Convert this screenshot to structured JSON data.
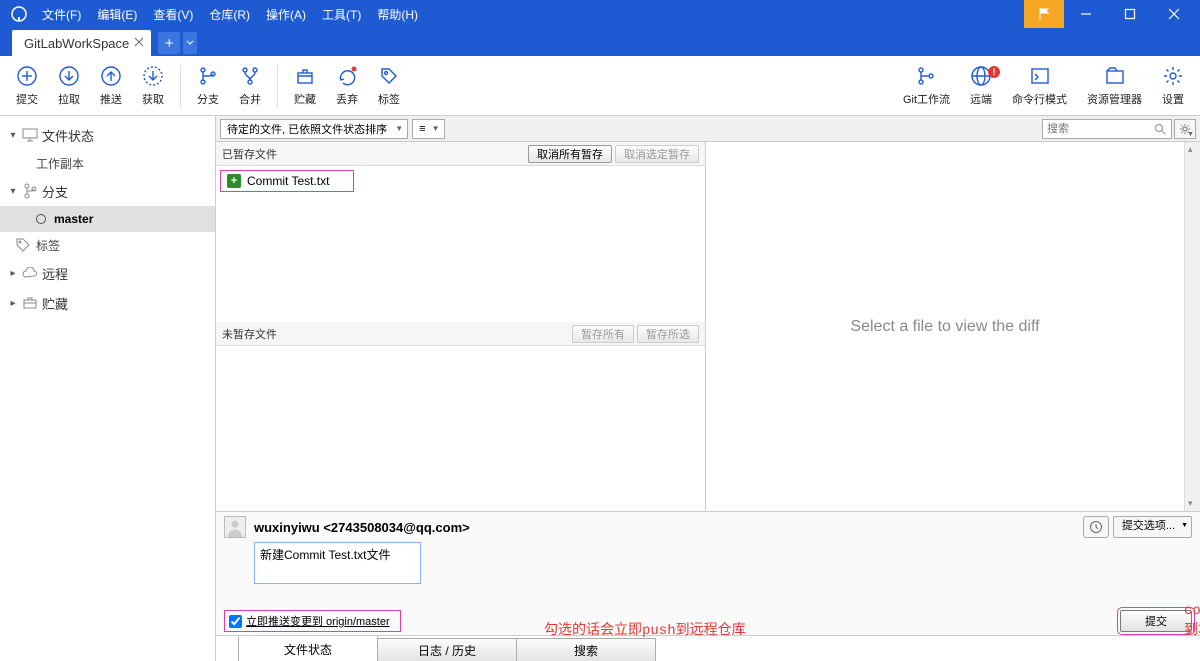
{
  "menu": {
    "file": "文件(F)",
    "edit": "编辑(E)",
    "view": "查看(V)",
    "repo": "仓库(R)",
    "action": "操作(A)",
    "tools": "工具(T)",
    "help": "帮助(H)"
  },
  "winTab": {
    "name": "GitLabWorkSpace"
  },
  "toolbar": {
    "commit": "提交",
    "pull": "拉取",
    "push": "推送",
    "fetch": "获取",
    "branch": "分支",
    "merge": "合并",
    "stash": "贮藏",
    "discard": "丢弃",
    "tag": "标签",
    "gitflow": "Git工作流",
    "remote": "远端",
    "terminal": "命令行模式",
    "explorer": "资源管理器",
    "settings": "设置"
  },
  "sidebar": {
    "fileStatus": "文件状态",
    "workingCopy": "工作副本",
    "branches": "分支",
    "master": "master",
    "tags": "标签",
    "remotes": "远程",
    "stashes": "贮藏"
  },
  "filter": {
    "combo": "待定的文件, 已依照文件状态排序",
    "list_icon": "≡",
    "search_placeholder": "搜索"
  },
  "staged": {
    "header": "已暂存文件",
    "unstage_all": "取消所有暂存",
    "unstage_sel": "取消选定暂存",
    "files": [
      {
        "name": "Commit Test.txt",
        "status": "+"
      }
    ]
  },
  "unstaged": {
    "header": "未暂存文件",
    "stage_all": "暂存所有",
    "stage_sel": "暂存所选"
  },
  "diff": {
    "placeholder": "Select a file to view the diff"
  },
  "commit": {
    "author": "wuxinyiwu <2743508034@qq.com>",
    "message": "新建Commit Test.txt文件",
    "options_btn": "提交选项...",
    "push_immediate": "立即推送变更到 origin/master",
    "commit_btn": "提交",
    "anno1": "勾选的话会立即push到远程仓库",
    "anno2": "commit到本地"
  },
  "bottomTabs": {
    "status": "文件状态",
    "log": "日志 / 历史",
    "search": "搜索"
  }
}
